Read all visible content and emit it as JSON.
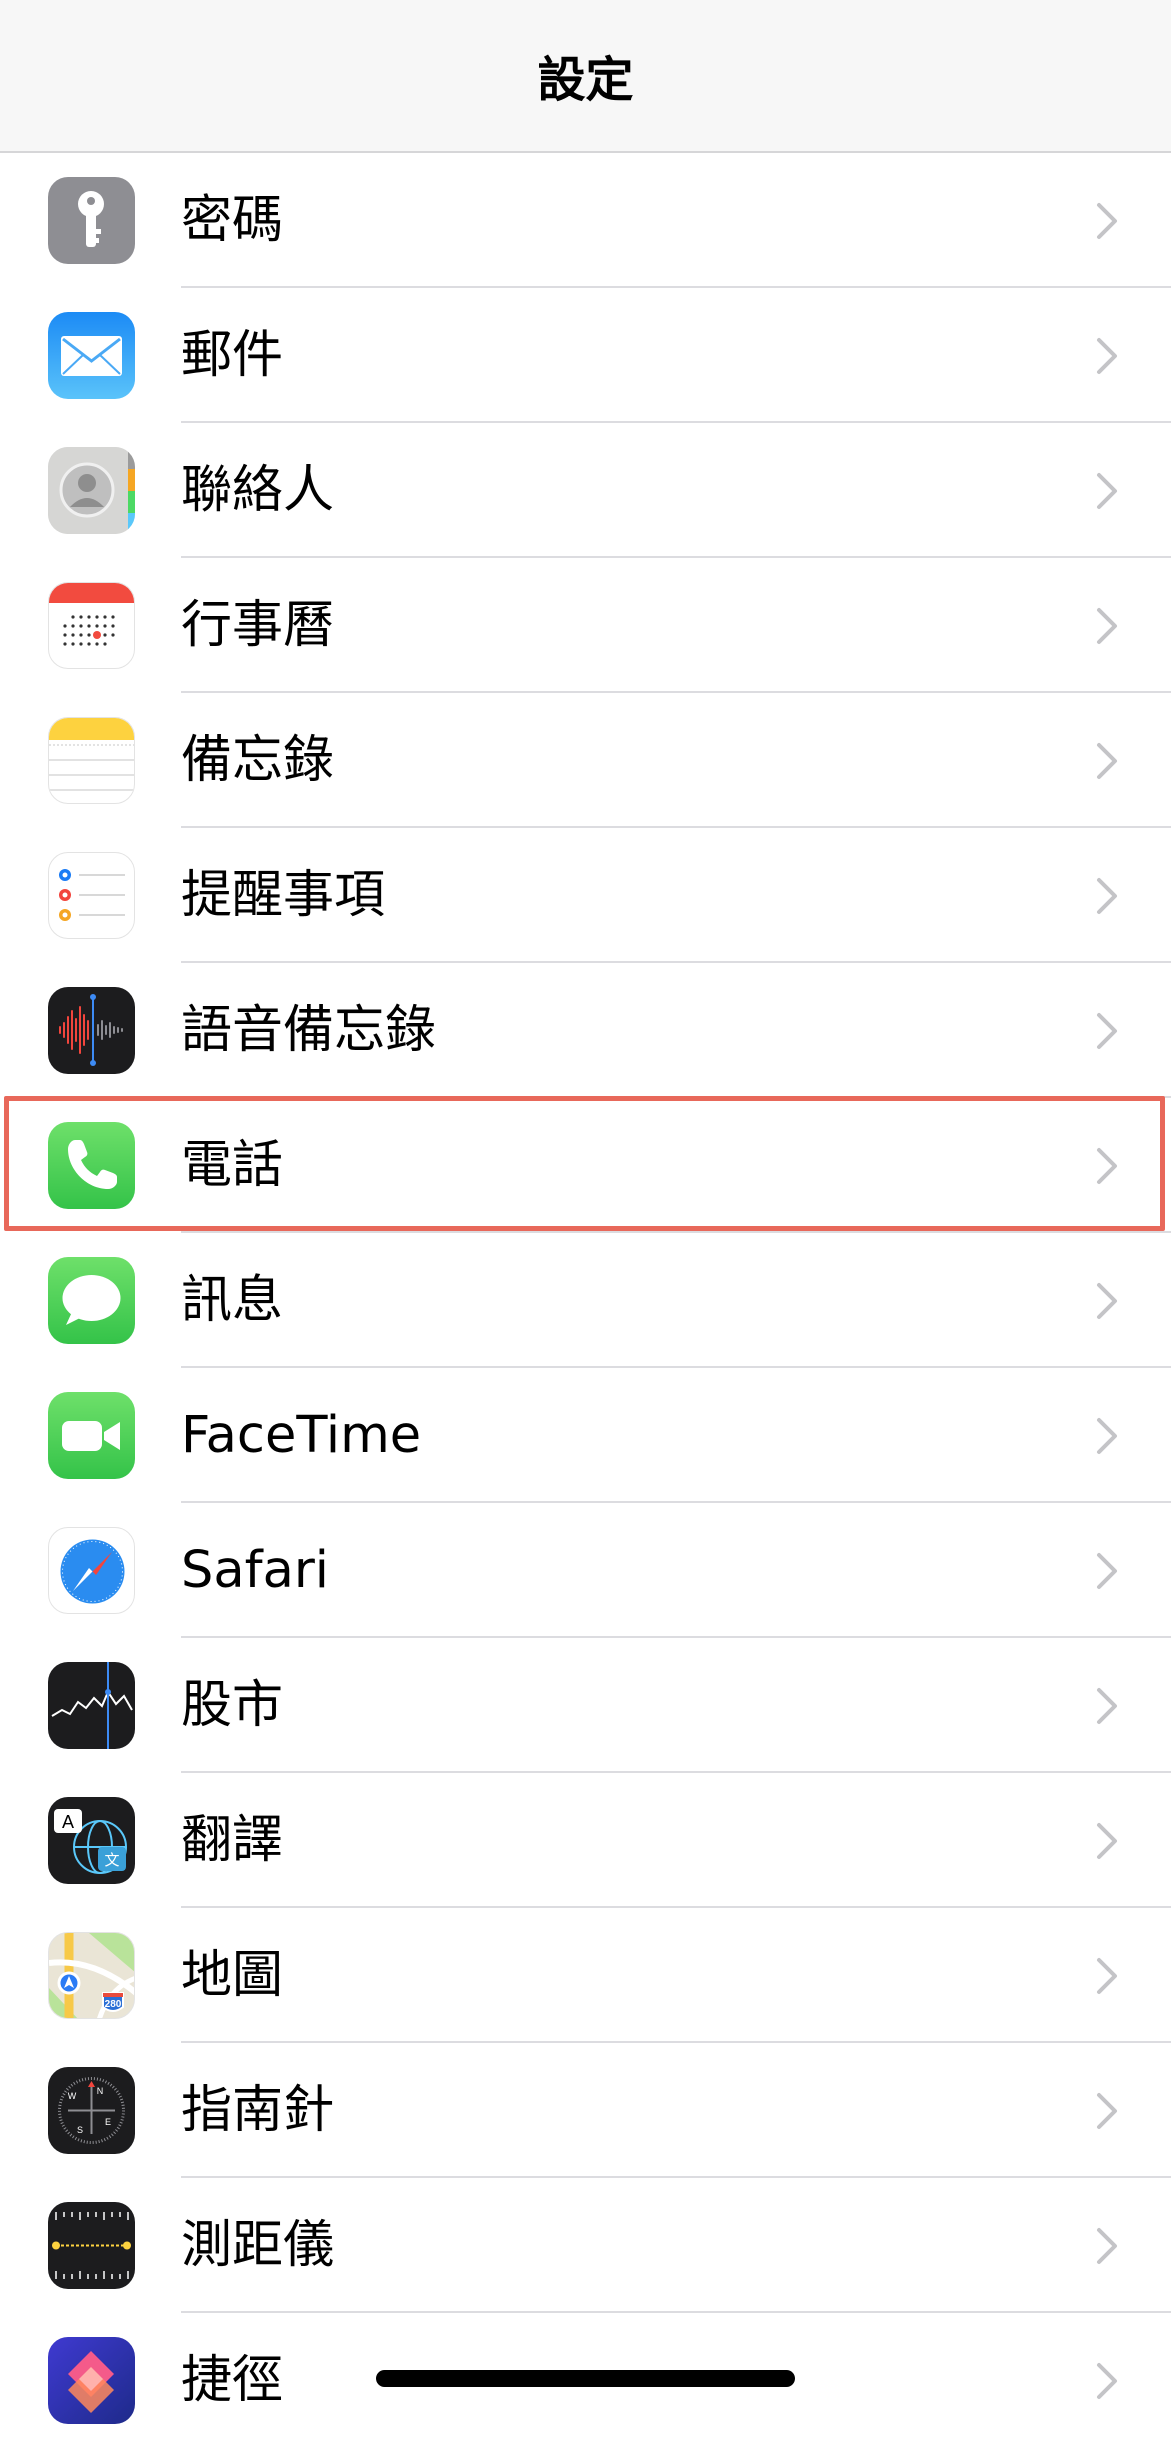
{
  "nav": {
    "title": "設定"
  },
  "settings": {
    "items": [
      {
        "label": "密碼",
        "icon": "key-icon"
      },
      {
        "label": "郵件",
        "icon": "mail-icon"
      },
      {
        "label": "聯絡人",
        "icon": "contacts-icon"
      },
      {
        "label": "行事曆",
        "icon": "calendar-icon"
      },
      {
        "label": "備忘錄",
        "icon": "notes-icon"
      },
      {
        "label": "提醒事項",
        "icon": "reminders-icon"
      },
      {
        "label": "語音備忘錄",
        "icon": "voice-memos-icon"
      },
      {
        "label": "電話",
        "icon": "phone-icon",
        "highlighted": true
      },
      {
        "label": "訊息",
        "icon": "messages-icon"
      },
      {
        "label": "FaceTime",
        "icon": "facetime-icon"
      },
      {
        "label": "Safari",
        "icon": "safari-icon"
      },
      {
        "label": "股市",
        "icon": "stocks-icon"
      },
      {
        "label": "翻譯",
        "icon": "translate-icon"
      },
      {
        "label": "地圖",
        "icon": "maps-icon"
      },
      {
        "label": "指南針",
        "icon": "compass-icon"
      },
      {
        "label": "測距儀",
        "icon": "measure-icon"
      },
      {
        "label": "捷徑",
        "icon": "shortcuts-icon"
      }
    ]
  },
  "translate_icon_glyphs": {
    "a": "A",
    "b": "文"
  },
  "maps_icon_shield": "280",
  "compass_icon_letters": {
    "n": "N",
    "e": "E",
    "s": "S",
    "w": "W"
  },
  "colors": {
    "highlight": "#e8685a",
    "separator": "#dcdce0",
    "chevron": "#c4c4c7"
  }
}
